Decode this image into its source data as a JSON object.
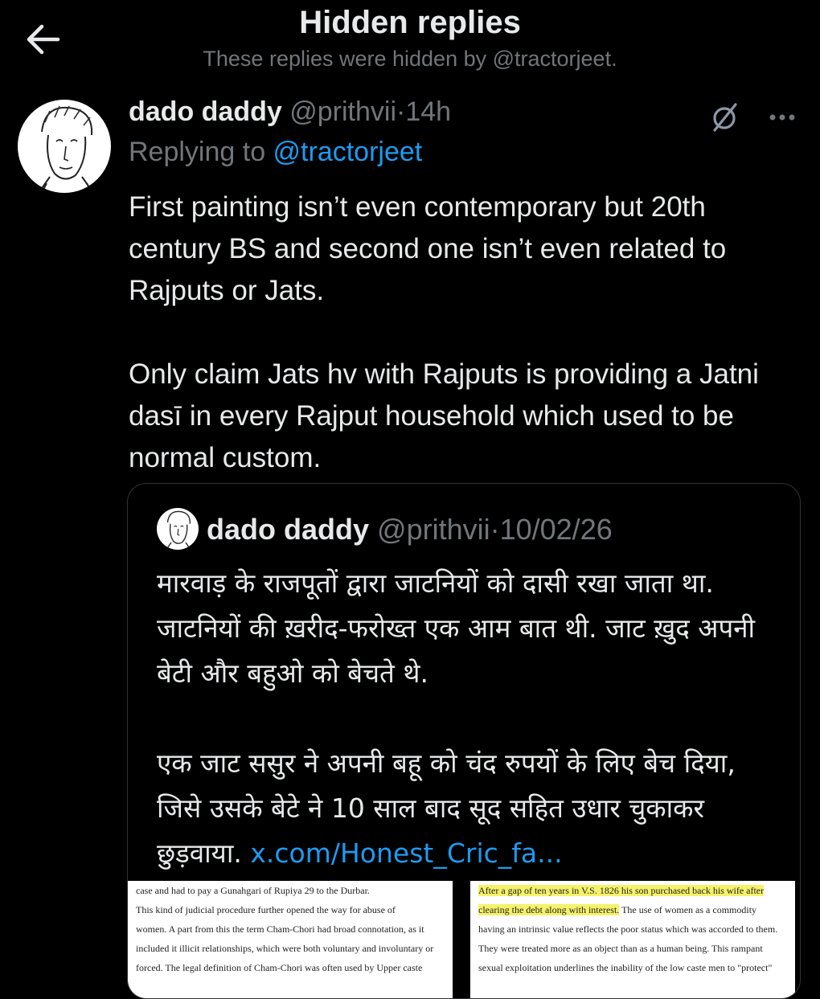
{
  "header": {
    "title": "Hidden replies",
    "subtitle": "These replies were hidden by @tractorjeet.",
    "back_icon": "arrow-left-icon"
  },
  "tweet": {
    "display_name": "dado daddy",
    "handle": "@prithvii",
    "time": "·14h",
    "replying_prefix": "Replying to ",
    "replying_to": "@tractorjeet",
    "body": "First painting isn’t even contemporary but 20th century BS and second one isn’t even related to Rajputs or Jats.\n\nOnly claim Jats hv with Rajputs is providing a Jatni dasī in every Rajput household which used to be normal custom.",
    "icons": {
      "hide": "hidden-reply-icon",
      "more": "more-icon"
    }
  },
  "quote": {
    "display_name": "dado daddy",
    "handle": "@prithvii",
    "date": "·10/02/26",
    "body": "मारवाड़ के राजपूतों द्वारा जाटनियों को दासी रखा जाता था. जाटनियों की ख़रीद-फरोख्त एक आम बात थी. जाट ख़ुद अपनी बेटी और बहुओ को बेचते थे.\n\nएक जाट ससुर ने अपनी बहू को चंद रुपयों के लिए बेच दिया, जिसे उसके बेटे ने 10 साल बाद सूद सहित उधार चुकाकर छुड़वाया. ",
    "link": "x.com/Honest_Cric_fa...",
    "image1_lines": [
      "case and had to pay a Gunahgari of Rupiya 29 to the Durbar.",
      "This kind of judicial procedure further opened the way for abuse of",
      "women. A part from this the term Cham-Chori had broad connotation, as it",
      "included it illicit relationships, which were both voluntary and involuntary or",
      "forced. The legal definition of Cham-Chori was often used by Upper caste"
    ],
    "image2_hl1": "After a gap of ten years in V.S. 1826 his son purchased back his wife after",
    "image2_hl2": "clearing the debt along with interest.",
    "image2_rest2": " The use of women as a commodity",
    "image2_lines": [
      "having an intrinsic value reflects the poor status which was accorded to them.",
      "They were treated more as an object than as a human being. This rampant",
      "sexual exploitation underlines the inability of the low caste men to \"protect\""
    ]
  },
  "colors": {
    "background": "#000000",
    "text": "#e7e9ea",
    "muted": "#71767b",
    "accent": "#1d9bf0",
    "border": "#2f3336",
    "highlight": "#f5f26a"
  }
}
